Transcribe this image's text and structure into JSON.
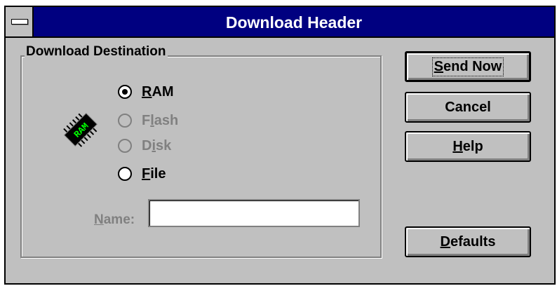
{
  "window": {
    "title": "Download Header"
  },
  "group": {
    "label": "Download Destination"
  },
  "radios": {
    "ram": {
      "mnemonic": "R",
      "rest": "AM",
      "selected": true,
      "enabled": true
    },
    "flash": {
      "pre": "F",
      "mnemonic": "l",
      "rest": "ash",
      "selected": false,
      "enabled": false
    },
    "disk": {
      "pre": "D",
      "mnemonic": "i",
      "rest": "sk",
      "selected": false,
      "enabled": false
    },
    "file": {
      "mnemonic": "F",
      "rest": "ile",
      "selected": false,
      "enabled": true
    }
  },
  "chip": {
    "text": "RAM",
    "icon": "ram-chip-icon"
  },
  "name_field": {
    "mnemonic": "N",
    "rest": "ame:",
    "value": ""
  },
  "buttons": {
    "send_now": {
      "mnemonic": "S",
      "rest": "end Now"
    },
    "cancel": {
      "label": "Cancel"
    },
    "help": {
      "mnemonic": "H",
      "rest": "elp"
    },
    "defaults": {
      "mnemonic": "D",
      "rest": "efaults"
    }
  },
  "colors": {
    "titlebar": "#000080",
    "face": "#c0c0c0",
    "disabled_text": "#808080",
    "chip_led": "#00ff00"
  }
}
